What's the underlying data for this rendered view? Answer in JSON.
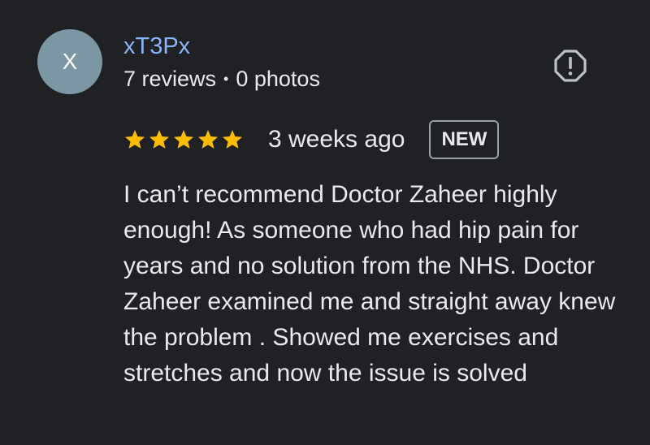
{
  "reviewer": {
    "initial": "X",
    "name": "xT3Px",
    "reviews": "7 reviews",
    "separator": "•",
    "photos": "0 photos",
    "avatar_color": "#7b97a3",
    "name_color": "#8ab4f8"
  },
  "report_icon": "report-flag-icon",
  "rating": {
    "stars": 5,
    "max_stars": 5,
    "star_color": "#fbbc04"
  },
  "time_ago": "3 weeks ago",
  "badge": "NEW",
  "review_text": "I can’t recommend Doctor Zaheer highly enough! As someone who had hip pain for years and no solution from the NHS. Doctor Zaheer examined me and straight away knew the problem . Showed me exercises and stretches and now the issue is solved"
}
